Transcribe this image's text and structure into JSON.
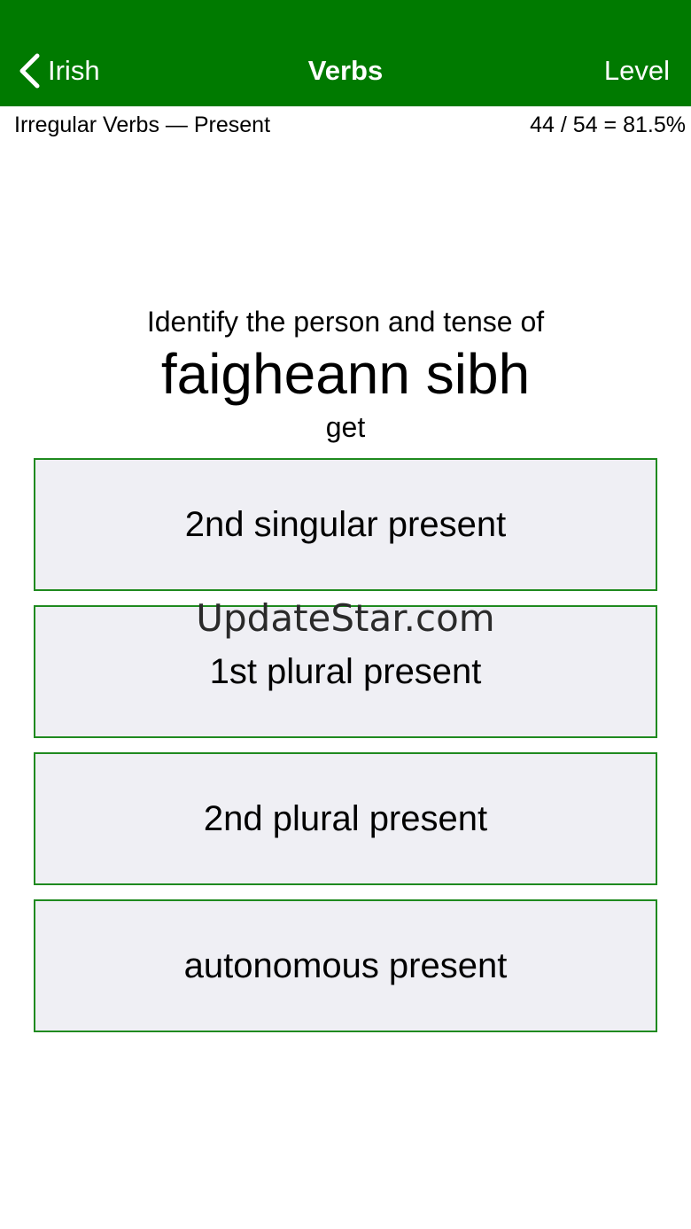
{
  "nav": {
    "back_label": "Irish",
    "title": "Verbs",
    "right_label": "Level",
    "bar_color": "#007a00"
  },
  "subheader": {
    "category": "Irregular Verbs — Present",
    "score": "44 / 54 = 81.5%"
  },
  "question": {
    "prompt": "Identify the person and tense of",
    "word": "faigheann sibh",
    "meaning": "get"
  },
  "options": [
    {
      "label": "2nd singular present"
    },
    {
      "label": "1st plural present"
    },
    {
      "label": "2nd plural present"
    },
    {
      "label": "autonomous present"
    }
  ],
  "watermark": "UpdateStar.com",
  "colors": {
    "option_background": "#efeff4",
    "option_border": "#1f8a1f"
  }
}
